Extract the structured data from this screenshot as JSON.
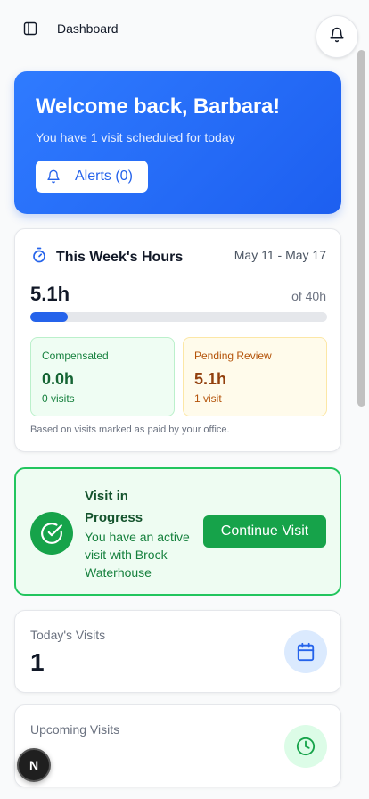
{
  "header": {
    "title": "Dashboard",
    "sidebar_icon": "sidebar-toggle-icon",
    "bell_icon": "bell-icon"
  },
  "welcome": {
    "title": "Welcome back, Barbara!",
    "subtitle": "You have 1 visit scheduled for today",
    "alerts_label": "Alerts (0)"
  },
  "hours": {
    "title": "This Week's Hours",
    "range": "May 11 - May 17",
    "value": "5.1h",
    "of_label": "of 40h",
    "progress_fraction": 0.1275,
    "compensated": {
      "label": "Compensated",
      "value": "0.0h",
      "sub": "0 visits"
    },
    "pending": {
      "label": "Pending Review",
      "value": "5.1h",
      "sub": "1 visit"
    },
    "note": "Based on visits marked as paid by your office."
  },
  "visit": {
    "title": "Visit in Progress",
    "description": "You have an active visit with Brock Waterhouse",
    "button_label": "Continue Visit"
  },
  "today": {
    "label": "Today's Visits",
    "value": "1"
  },
  "upcoming": {
    "label": "Upcoming Visits"
  },
  "badge": {
    "label": "N"
  },
  "colors": {
    "primary": "#2563eb",
    "success": "#16a34a",
    "warning": "#b45309"
  }
}
